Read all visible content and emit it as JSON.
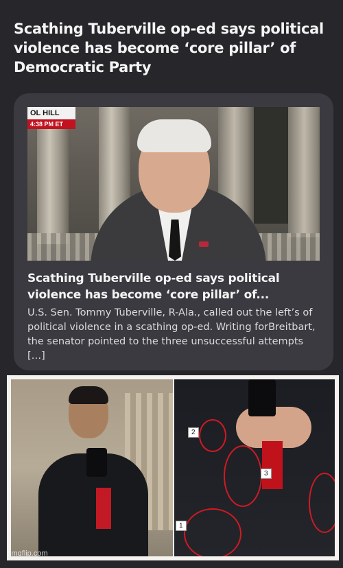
{
  "article": {
    "headline": "Scathing Tuberville op-ed says political violence has become ‘core pillar’ of Democratic Party"
  },
  "card": {
    "chyron_top": "OL HILL",
    "chyron_time": "4:38 PM ET",
    "title": "Scathing Tuberville op-ed says political violence has become ‘core pillar’ of...",
    "snippet": "U.S. Sen. Tommy Tuberville, R-Ala., called out the left’s of political violence in a scathing op-ed. Writing forBreitbart, the senator pointed to the three unsuccessful attempts […]"
  },
  "photo": {
    "labels": [
      "2",
      "3",
      "1"
    ]
  },
  "watermark": "imgflip.com",
  "colors": {
    "background": "#26262b",
    "card": "#3a3a40",
    "accent_red": "#d11a22"
  }
}
